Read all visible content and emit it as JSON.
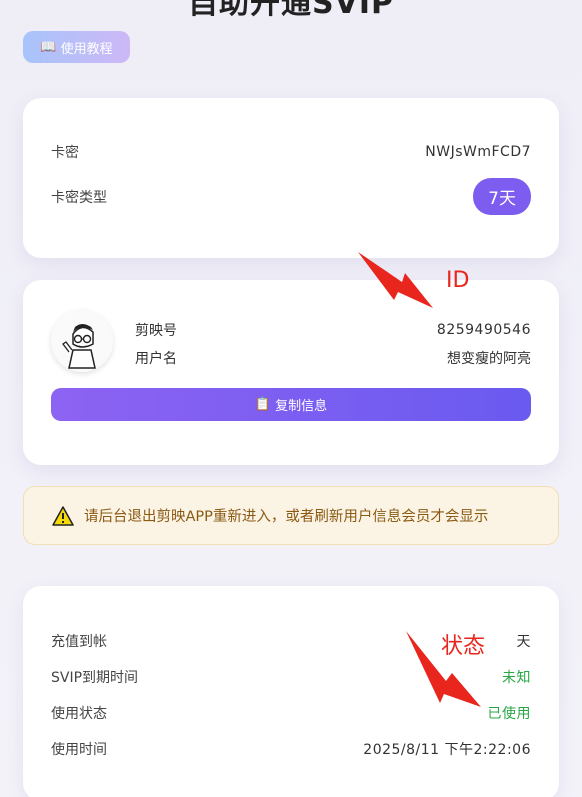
{
  "page": {
    "title": "自助开通SVIP"
  },
  "tutorial": {
    "icon": "book-icon",
    "label": "使用教程"
  },
  "card_info": {
    "key_label": "卡密",
    "key_value": "NWJsWmFCD7",
    "type_label": "卡密类型",
    "type_value": "7天"
  },
  "account": {
    "id_label": "剪映号",
    "id_value": "8259490546",
    "name_label": "用户名",
    "name_value": "想变瘦的阿亮",
    "copy_icon": "clipboard-icon",
    "copy_label": "复制信息"
  },
  "notice": {
    "icon": "warning-icon",
    "text": "请后台退出剪映APP重新进入，或者刷新用户信息会员才会显示"
  },
  "status": {
    "recharge_label": "充值到帐",
    "recharge_value": "天",
    "expire_label": "SVIP到期时间",
    "expire_value": "未知",
    "state_label": "使用状态",
    "state_value": "已使用",
    "time_label": "使用时间",
    "time_value": "2025/8/11 下午2:22:06"
  },
  "annotations": {
    "id": "ID",
    "status": "状态"
  },
  "colors": {
    "accent": "#7d5cf0",
    "success": "#28a745",
    "annotation": "#e8261e"
  }
}
